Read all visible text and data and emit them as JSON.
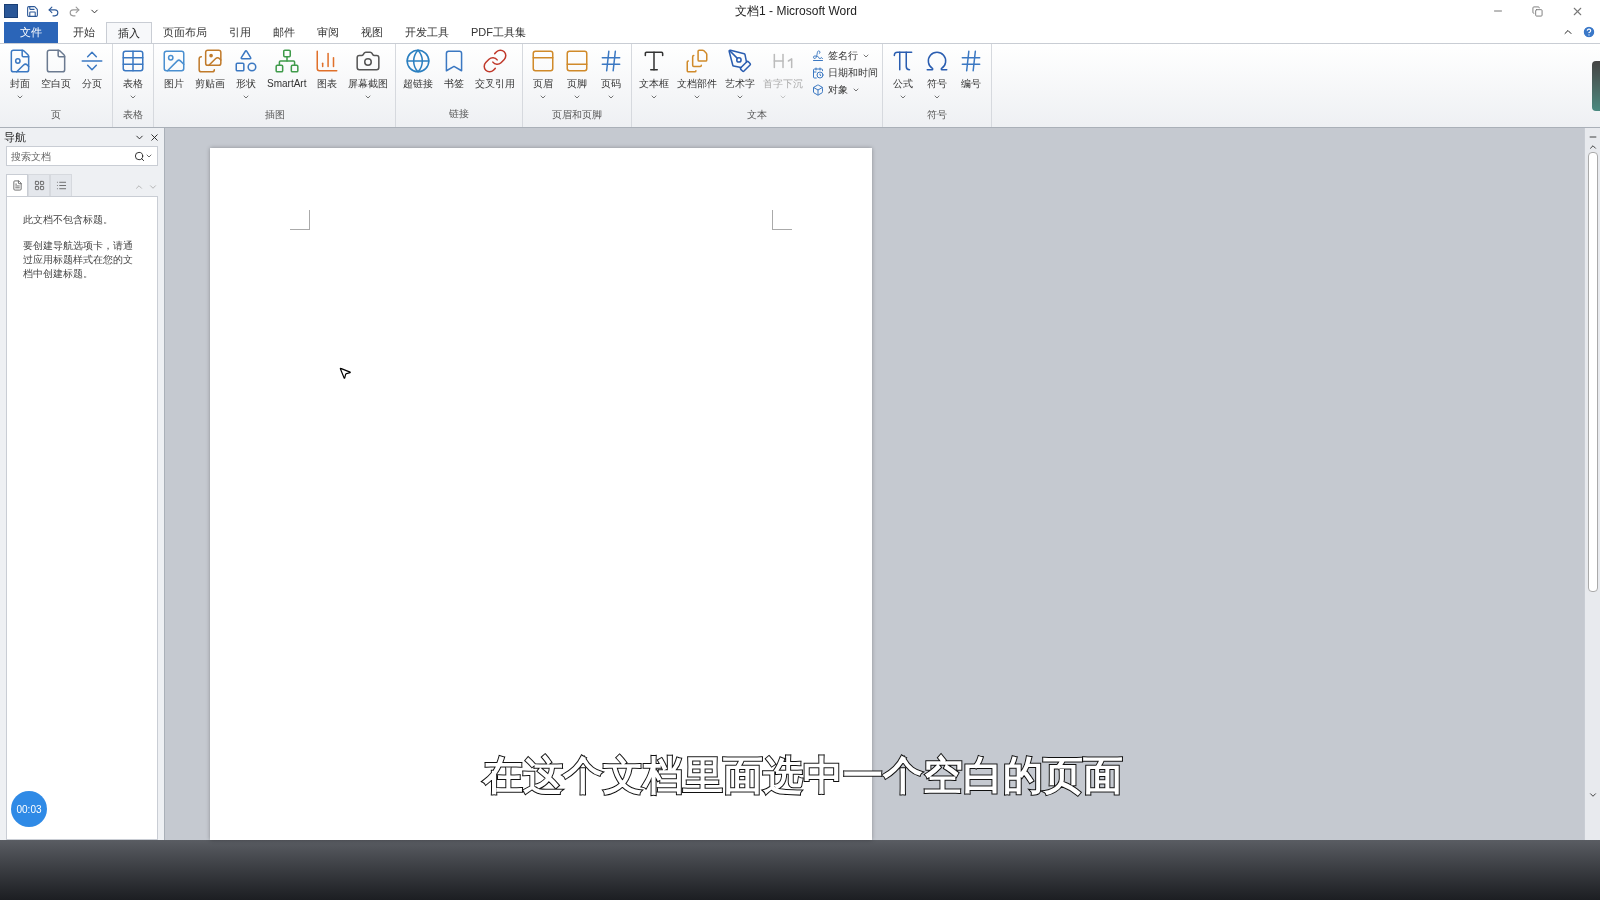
{
  "window": {
    "title": "文档1 - Microsoft Word"
  },
  "tabs": [
    {
      "label": "文件",
      "selected": false,
      "kind": "file"
    },
    {
      "label": "开始",
      "selected": false,
      "kind": "tab"
    },
    {
      "label": "插入",
      "selected": true,
      "kind": "tab"
    },
    {
      "label": "页面布局",
      "selected": false,
      "kind": "tab"
    },
    {
      "label": "引用",
      "selected": false,
      "kind": "tab"
    },
    {
      "label": "邮件",
      "selected": false,
      "kind": "tab"
    },
    {
      "label": "审阅",
      "selected": false,
      "kind": "tab"
    },
    {
      "label": "视图",
      "selected": false,
      "kind": "tab"
    },
    {
      "label": "开发工具",
      "selected": false,
      "kind": "tab"
    },
    {
      "label": "PDF工具集",
      "selected": false,
      "kind": "tab"
    }
  ],
  "ribbon_groups": [
    {
      "label": "页",
      "items": [
        {
          "label": "封面",
          "dropdown": true,
          "disabled": false
        },
        {
          "label": "空白页",
          "dropdown": false,
          "disabled": false
        },
        {
          "label": "分页",
          "dropdown": false,
          "disabled": false
        }
      ]
    },
    {
      "label": "表格",
      "items": [
        {
          "label": "表格",
          "dropdown": true,
          "disabled": false
        }
      ]
    },
    {
      "label": "插图",
      "items": [
        {
          "label": "图片",
          "dropdown": false,
          "disabled": false
        },
        {
          "label": "剪贴画",
          "dropdown": false,
          "disabled": false
        },
        {
          "label": "形状",
          "dropdown": true,
          "disabled": false
        },
        {
          "label": "SmartArt",
          "dropdown": false,
          "disabled": false
        },
        {
          "label": "图表",
          "dropdown": false,
          "disabled": false
        },
        {
          "label": "屏幕截图",
          "dropdown": true,
          "disabled": false
        }
      ]
    },
    {
      "label": "链接",
      "items": [
        {
          "label": "超链接",
          "dropdown": false,
          "disabled": false
        },
        {
          "label": "书签",
          "dropdown": false,
          "disabled": false
        },
        {
          "label": "交叉引用",
          "dropdown": false,
          "disabled": false
        }
      ]
    },
    {
      "label": "页眉和页脚",
      "items": [
        {
          "label": "页眉",
          "dropdown": true,
          "disabled": false
        },
        {
          "label": "页脚",
          "dropdown": true,
          "disabled": false
        },
        {
          "label": "页码",
          "dropdown": true,
          "disabled": false
        }
      ]
    },
    {
      "label": "文本",
      "items": [
        {
          "label": "文本框",
          "dropdown": true,
          "disabled": false
        },
        {
          "label": "文档部件",
          "dropdown": true,
          "disabled": false
        },
        {
          "label": "艺术字",
          "dropdown": true,
          "disabled": false
        },
        {
          "label": "首字下沉",
          "dropdown": true,
          "disabled": true
        }
      ],
      "small_items": [
        {
          "label": "签名行",
          "dropdown": true
        },
        {
          "label": "日期和时间",
          "dropdown": false
        },
        {
          "label": "对象",
          "dropdown": true
        }
      ]
    },
    {
      "label": "符号",
      "items": [
        {
          "label": "公式",
          "dropdown": true,
          "disabled": false
        },
        {
          "label": "符号",
          "dropdown": true,
          "disabled": false
        },
        {
          "label": "编号",
          "dropdown": false,
          "disabled": false
        }
      ]
    }
  ],
  "navigation": {
    "title": "导航",
    "search": {
      "placeholder": "搜索文档"
    },
    "view_tabs": [
      {
        "selected": true
      },
      {
        "selected": false
      },
      {
        "selected": false
      }
    ],
    "messages": [
      "此文档不包含标题。",
      "要创建导航选项卡，请通过应用标题样式在您的文档中创建标题。"
    ]
  },
  "timer": "00:03",
  "caption": "在这个文档里面选中一个空白的页面"
}
